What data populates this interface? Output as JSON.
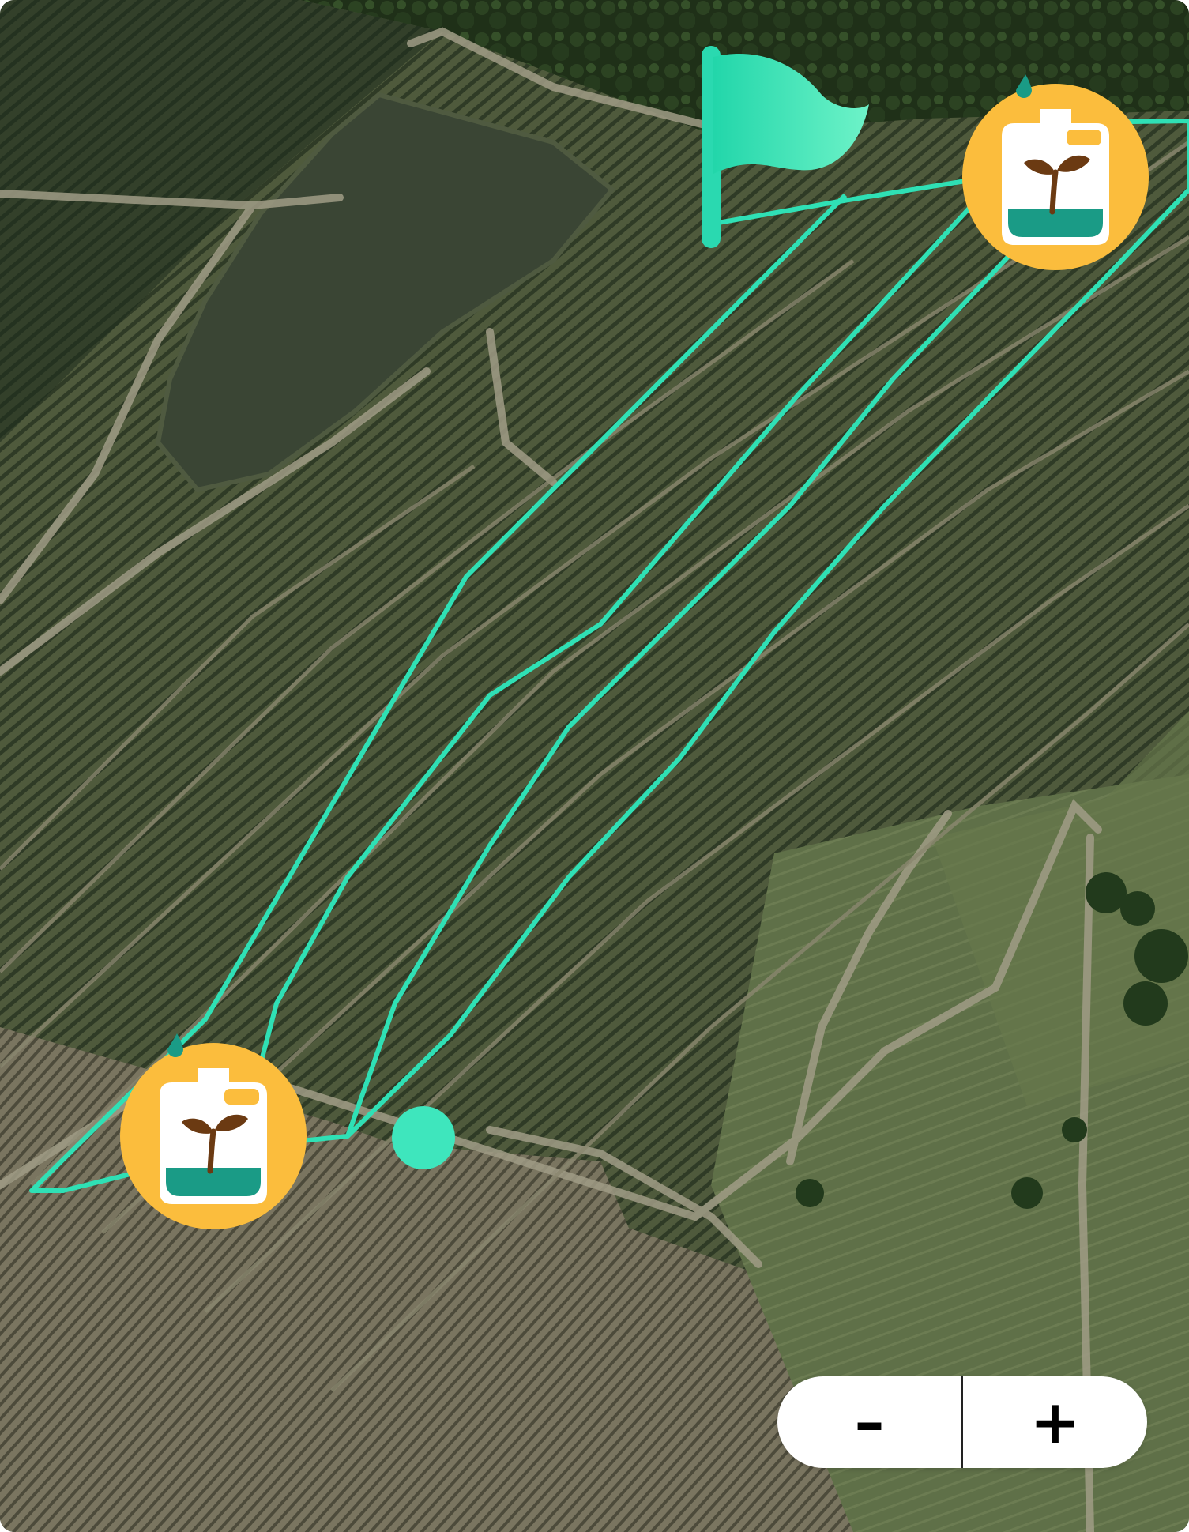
{
  "map": {
    "view": "satellite",
    "colors": {
      "field_boundary": "#2fe0b5",
      "marker_badge": "#fbbd3d",
      "canister_fill": "#1a9b86",
      "sprout": "#6b3a12",
      "drop": "#1a9b86"
    },
    "markers": [
      {
        "name": "fertilizer-canister",
        "icon": "canister-sprout-icon"
      },
      {
        "name": "fertilizer-canister",
        "icon": "canister-sprout-icon"
      },
      {
        "name": "start-flag",
        "icon": "flag-icon"
      },
      {
        "name": "route-point",
        "icon": "dot-icon"
      }
    ]
  },
  "zoom": {
    "out_label": "–",
    "in_label": "+"
  }
}
